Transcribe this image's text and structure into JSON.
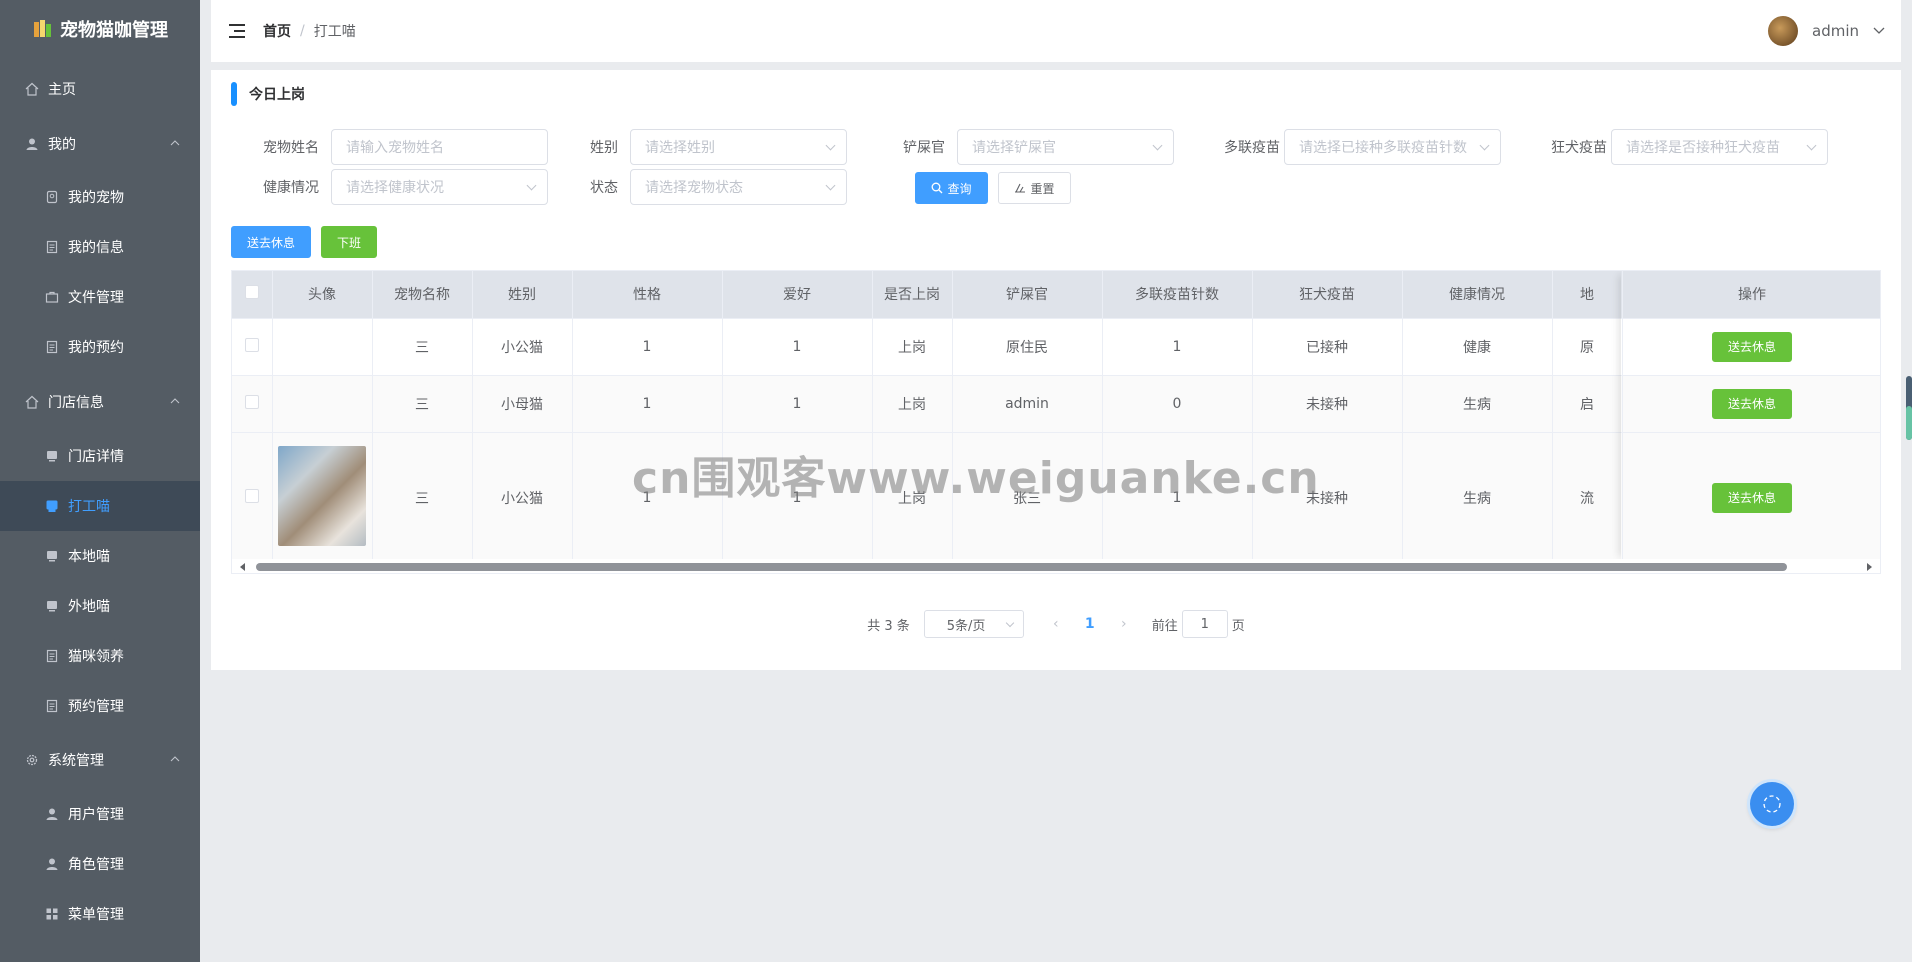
{
  "app": {
    "title": "宠物猫咖管理"
  },
  "sidebar": {
    "items": [
      {
        "label": "主页",
        "type": "top",
        "icon": "home-icon"
      },
      {
        "label": "我的",
        "type": "group",
        "icon": "user-icon"
      },
      {
        "label": "我的宠物",
        "type": "sub",
        "icon": "pet-icon"
      },
      {
        "label": "我的信息",
        "type": "sub",
        "icon": "document-icon"
      },
      {
        "label": "文件管理",
        "type": "sub",
        "icon": "briefcase-icon"
      },
      {
        "label": "我的预约",
        "type": "sub",
        "icon": "document-icon"
      },
      {
        "label": "门店信息",
        "type": "group",
        "icon": "home-icon"
      },
      {
        "label": "门店详情",
        "type": "sub",
        "icon": "monitor-icon"
      },
      {
        "label": "打工喵",
        "type": "sub",
        "icon": "monitor-icon",
        "active": true
      },
      {
        "label": "本地喵",
        "type": "sub",
        "icon": "monitor-icon"
      },
      {
        "label": "外地喵",
        "type": "sub",
        "icon": "monitor-icon"
      },
      {
        "label": "猫咪领养",
        "type": "sub",
        "icon": "document-icon"
      },
      {
        "label": "预约管理",
        "type": "sub",
        "icon": "document-icon"
      },
      {
        "label": "系统管理",
        "type": "group",
        "icon": "gear-icon"
      },
      {
        "label": "用户管理",
        "type": "sub",
        "icon": "user-icon"
      },
      {
        "label": "角色管理",
        "type": "sub",
        "icon": "user-icon"
      },
      {
        "label": "菜单管理",
        "type": "sub",
        "icon": "grid-icon"
      }
    ]
  },
  "header": {
    "breadcrumb_home": "首页",
    "breadcrumb_sep": "/",
    "breadcrumb_current": "打工喵",
    "username": "admin"
  },
  "card": {
    "title": "今日上岗"
  },
  "filters": {
    "pet_name": {
      "label": "宠物姓名",
      "placeholder": "请输入宠物姓名"
    },
    "gender": {
      "label": "姓别",
      "placeholder": "请选择姓别"
    },
    "owner": {
      "label": "铲屎官",
      "placeholder": "请选择铲屎官"
    },
    "multi_vaccine": {
      "label": "多联疫苗",
      "placeholder": "请选择已接种多联疫苗针数"
    },
    "rabies": {
      "label": "狂犬疫苗",
      "placeholder": "请选择是否接种狂犬疫苗"
    },
    "health": {
      "label": "健康情况",
      "placeholder": "请选择健康状况"
    },
    "status": {
      "label": "状态",
      "placeholder": "请选择宠物状态"
    },
    "query_label": "查询",
    "reset_label": "重置"
  },
  "actions": {
    "rest_label": "送去休息",
    "off_label": "下班"
  },
  "table": {
    "columns": [
      "头像",
      "宠物名称",
      "姓别",
      "性格",
      "爱好",
      "是否上岗",
      "铲屎官",
      "多联疫苗针数",
      "狂犬疫苗",
      "健康情况",
      "地",
      "操作"
    ],
    "rows": [
      {
        "avatar": false,
        "name": "三",
        "gender": "小公猫",
        "personality": "1",
        "hobby": "1",
        "on_duty": "上岗",
        "owner": "原住民",
        "multi": "1",
        "rabies": "已接种",
        "health": "健康",
        "origin": "原",
        "op": "送去休息"
      },
      {
        "avatar": false,
        "name": "三",
        "gender": "小母猫",
        "personality": "1",
        "hobby": "1",
        "on_duty": "上岗",
        "owner": "admin",
        "multi": "0",
        "rabies": "未接种",
        "health": "生病",
        "origin": "启",
        "op": "送去休息"
      },
      {
        "avatar": true,
        "name": "三",
        "gender": "小公猫",
        "personality": "1",
        "hobby": "1",
        "on_duty": "上岗",
        "owner": "张三",
        "multi": "1",
        "rabies": "未接种",
        "health": "生病",
        "origin": "流",
        "op": "送去休息"
      }
    ]
  },
  "pagination": {
    "total": "共 3 条",
    "page_size": "5条/页",
    "current": "1",
    "goto_prefix": "前往",
    "goto_value": "1",
    "goto_suffix": "页"
  },
  "watermark": "cn围观客www.weiguanke.cn",
  "colors": {
    "primary": "#409eff",
    "success": "#67c23a",
    "sidebar_bg": "#545c64"
  }
}
